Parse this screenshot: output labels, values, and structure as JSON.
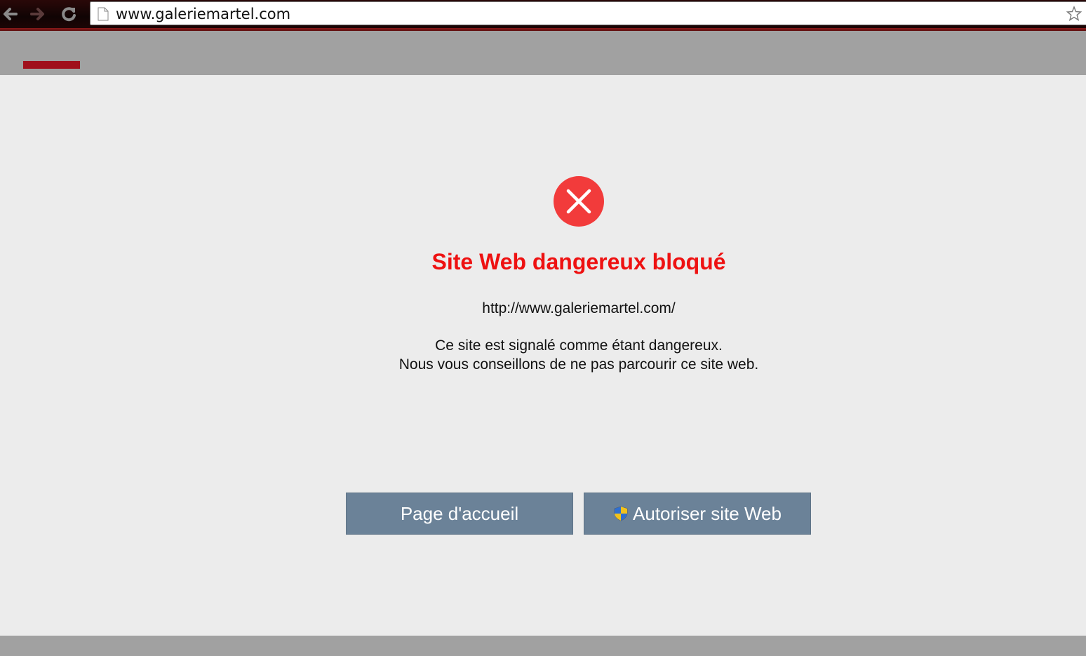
{
  "browser": {
    "address_bar": {
      "url": "www.galeriemartel.com",
      "page_icon": "page-icon",
      "star_icon": "star-icon"
    },
    "nav": {
      "back_icon": "back-arrow-icon",
      "forward_icon": "forward-arrow-icon",
      "reload_icon": "reload-icon"
    }
  },
  "colors": {
    "title_red": "#ee1111",
    "button_blue_gray": "#6b8298",
    "band_gray": "#a1a1a1",
    "accent_red": "#a0101c",
    "background": "#ececec",
    "error_icon_red": "#f23b3b"
  },
  "warning": {
    "icon": "error-x-circle-icon",
    "title": "Site Web dangereux bloqué",
    "blocked_url": "http://www.galeriemartel.com/",
    "message_line1": "Ce site est signalé comme étant dangereux.",
    "message_line2": "Nous vous conseillons de ne pas parcourir ce site web."
  },
  "buttons": {
    "home_label": "Page d'accueil",
    "allow_label": "Autoriser site Web",
    "allow_icon": "uac-shield-icon"
  }
}
